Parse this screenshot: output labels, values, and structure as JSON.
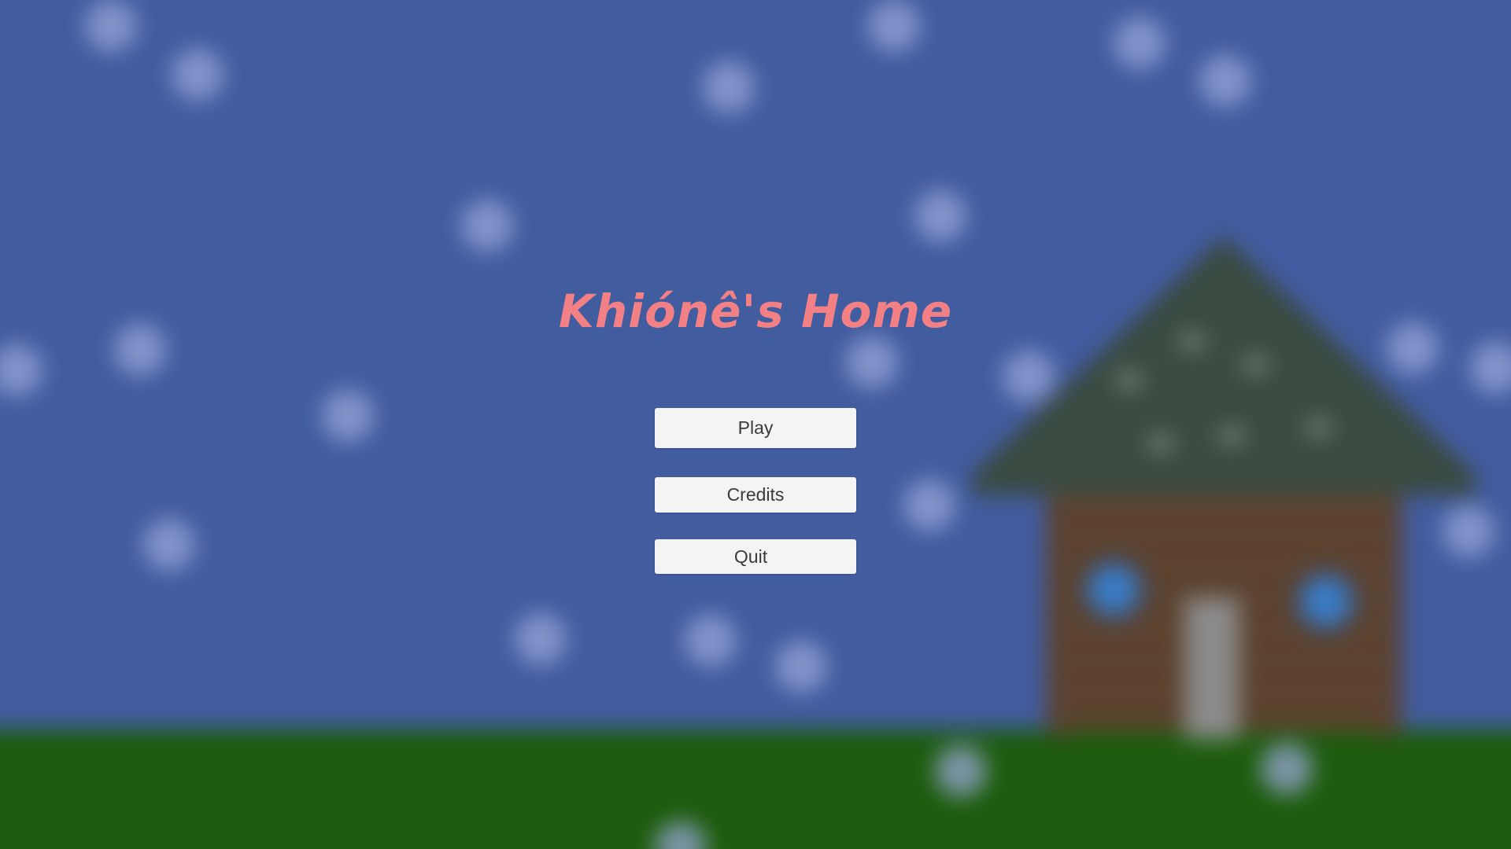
{
  "game": {
    "title": "Khiónê's Home"
  },
  "menu": {
    "play_label": "Play",
    "credits_label": "Credits",
    "quit_label": "Quit"
  },
  "colors": {
    "sky": "#425ca0",
    "ground": "#1d5c0e",
    "title": "#f28084",
    "button_bg": "#f4f4f4",
    "button_text": "#3a3a3a"
  },
  "background": {
    "scene": "blurred-snowy-night-with-cabin",
    "icons": [
      "snowflake-icon",
      "cabin-icon"
    ]
  }
}
